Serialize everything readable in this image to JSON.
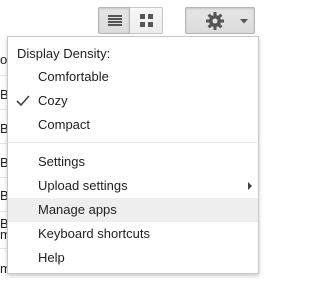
{
  "menu": {
    "header": "Display Density:",
    "density_options": [
      {
        "label": "Comfortable",
        "selected": false
      },
      {
        "label": "Cozy",
        "selected": true
      },
      {
        "label": "Compact",
        "selected": false
      }
    ],
    "items": [
      {
        "label": "Settings",
        "has_submenu": false
      },
      {
        "label": "Upload settings",
        "has_submenu": true
      },
      {
        "label": "Manage apps",
        "has_submenu": false,
        "highlighted": true
      },
      {
        "label": "Keyboard shortcuts",
        "has_submenu": false
      },
      {
        "label": "Help",
        "has_submenu": false
      }
    ]
  },
  "toolbar": {
    "list_view_icon": "list-view-icon",
    "grid_view_icon": "grid-view-icon",
    "settings_icon": "gear-icon",
    "dropdown_icon": "caret-down-icon"
  },
  "background_fragments": [
    "o",
    "B",
    "B",
    "B",
    "B",
    "B",
    "B",
    "m",
    "m"
  ]
}
